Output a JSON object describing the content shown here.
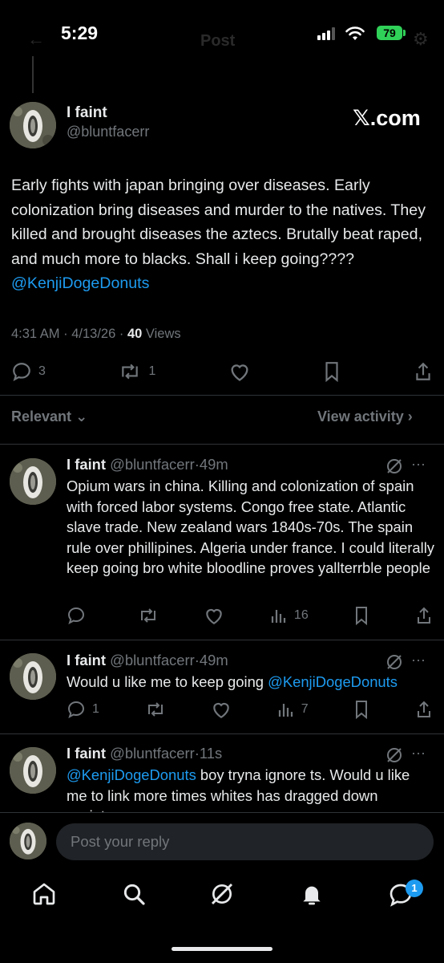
{
  "status_bar": {
    "time": "5:29",
    "battery": "79"
  },
  "header": {
    "ghost_title": "Post"
  },
  "main_post": {
    "name": "I faint",
    "handle": "@bluntfacerr",
    "watermark": "𝕏.com",
    "text": "Early fights with japan bringing over diseases. Early colonization bring diseases and murder to the natives. They killed and brought diseases the aztecs. Brutally beat raped, and much more to blacks.  Shall i keep going???? ",
    "mention": "@KenjiDogeDonuts",
    "time": "4:31 AM",
    "date": "4/13/26",
    "views_count": "40",
    "views_label": "Views",
    "replies": "3",
    "reposts": "1"
  },
  "sort_bar": {
    "relevant": "Relevant",
    "view_activity": "View activity"
  },
  "replies": [
    {
      "name": "I faint",
      "handle": "@bluntfacerr",
      "age": "49m",
      "text": "Opium wars in china. Killing and colonization of spain with forced labor systems. Congo free state. Atlantic slave trade. New zealand wars 1840s-70s. The spain rule over phillipines. Algeria under france.  I could literally keep going bro white bloodline proves yallterrble people",
      "mention_before": "",
      "reply_count": "",
      "views": "16"
    },
    {
      "name": "I faint",
      "handle": "@bluntfacerr",
      "age": "49m",
      "text": "Would u like me to keep going ",
      "mention_after": "@KenjiDogeDonuts",
      "reply_count": "1",
      "views": "7"
    },
    {
      "name": "I faint",
      "handle": "@bluntfacerr",
      "age": "11s",
      "mention_before": "@KenjiDogeDonuts",
      "text": " boy tryna ignore ts. Would u like me to link more times whites has dragged down society"
    }
  ],
  "composer": {
    "placeholder": "Post your reply"
  },
  "bottom_nav": {
    "notifications_badge": "1"
  },
  "colors": {
    "accent": "#1d9bf0",
    "muted": "#71767b",
    "text": "#e7e9ea",
    "background": "#000000"
  }
}
